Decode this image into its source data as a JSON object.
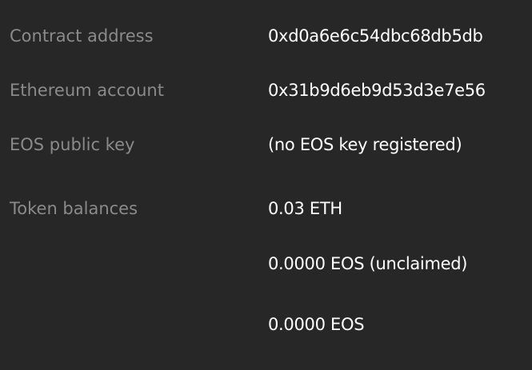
{
  "details": {
    "contract_address": {
      "label": "Contract address",
      "value": "0xd0a6e6c54dbc68db5db"
    },
    "ethereum_account": {
      "label": "Ethereum account",
      "value": "0x31b9d6eb9d53d3e7e56"
    },
    "eos_public_key": {
      "label": "EOS public key",
      "value": "(no EOS key registered)"
    },
    "token_balances": {
      "label": "Token balances",
      "values": [
        "0.03 ETH",
        "0.0000 EOS (unclaimed)",
        "0.0000 EOS"
      ]
    }
  },
  "colors": {
    "background": "#272727",
    "label": "#8a8a8a",
    "value": "#ffffff"
  }
}
